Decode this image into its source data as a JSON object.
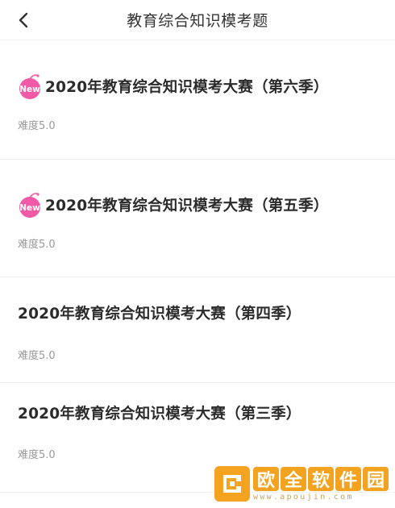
{
  "header": {
    "title": "教育综合知识模考题"
  },
  "items": [
    {
      "title": "2020年教育综合知识模考大赛（第六季）",
      "difficulty": "难度5.0",
      "is_new": true,
      "badge_label": "New"
    },
    {
      "title": "2020年教育综合知识模考大赛（第五季）",
      "difficulty": "难度5.0",
      "is_new": true,
      "badge_label": "New"
    },
    {
      "title": "2020年教育综合知识模考大赛（第四季）",
      "difficulty": "难度5.0",
      "is_new": false
    },
    {
      "title": "2020年教育综合知识模考大赛（第三季）",
      "difficulty": "难度5.0",
      "is_new": false
    }
  ],
  "watermark": {
    "chars": [
      "欧",
      "全",
      "软",
      "件",
      "园"
    ],
    "url": "www.apoujin.com"
  },
  "colors": {
    "badge_pink": "#f25aa8",
    "watermark_orange": "#f3a31f"
  },
  "icons": {
    "back": "chevron-left-icon",
    "new_badge": "new-badge-icon"
  }
}
